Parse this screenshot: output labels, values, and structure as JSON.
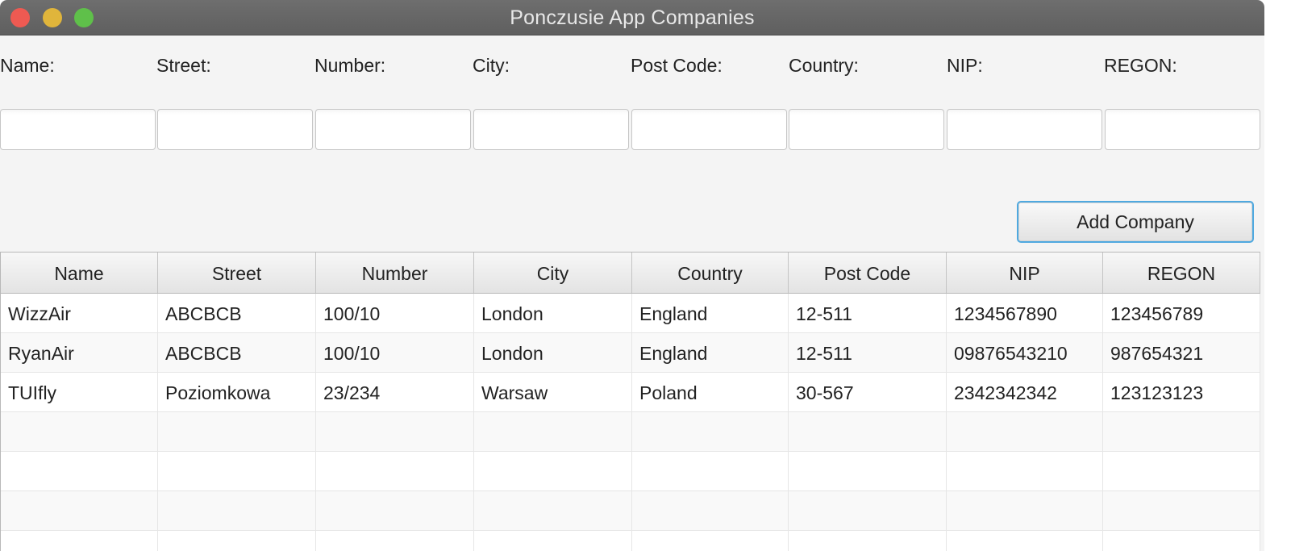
{
  "window": {
    "title": "Ponczusie App Companies"
  },
  "form": {
    "labels": [
      "Name:",
      "Street:",
      "Number:",
      "City:",
      "Post Code:",
      "Country:",
      "NIP:",
      "REGON:"
    ],
    "values": [
      "",
      "",
      "",
      "",
      "",
      "",
      "",
      ""
    ],
    "add_button_label": "Add Company"
  },
  "table": {
    "columns": [
      "Name",
      "Street",
      "Number",
      "City",
      "Country",
      "Post Code",
      "NIP",
      "REGON"
    ],
    "rows": [
      [
        "WizzAir",
        "ABCBCB",
        "100/10",
        "London",
        "England",
        "12-511",
        "1234567890",
        "123456789"
      ],
      [
        "RyanAir",
        "ABCBCB",
        "100/10",
        "London",
        "England",
        "12-511",
        "09876543210",
        "987654321"
      ],
      [
        "TUIfly",
        "Poziomkowa",
        "23/234",
        "Warsaw",
        "Poland",
        "30-567",
        "2342342342",
        "123123123"
      ]
    ]
  },
  "colors": {
    "titlebar": "#666666",
    "focus_accent": "#4fa9e0",
    "close": "#ee5a52",
    "minimize": "#e0b53b",
    "maximize": "#5fc04a"
  }
}
